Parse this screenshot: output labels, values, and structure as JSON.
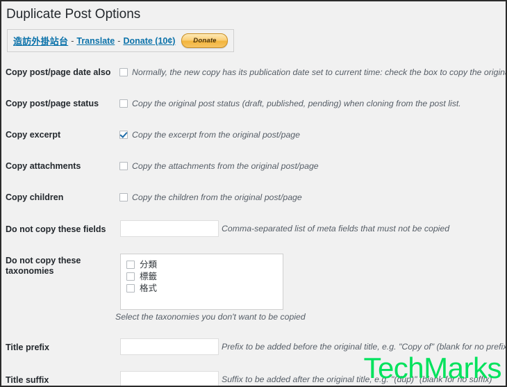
{
  "page": {
    "title": "Duplicate Post Options"
  },
  "linkbar": {
    "plugin_site_link": "造訪外掛站台",
    "translate_link": "Translate",
    "donate_link": "Donate (10¢)",
    "separator": "-",
    "donate_button": "Donate"
  },
  "colors": {
    "background": "#f1f1f1",
    "link": "#0b72aa",
    "title_text": "#23282d",
    "description_text": "#555d66",
    "checkbox_accent": "#1e6ca8",
    "watermark_green": "#00e25c",
    "border": "#2b2b2b"
  },
  "rows": [
    {
      "label": "Copy post/page date also",
      "type": "checkbox",
      "checked": false,
      "description": "Normally, the new copy has its publication date set to current time: check the box to copy the original p"
    },
    {
      "label": "Copy post/page status",
      "type": "checkbox",
      "checked": false,
      "description": "Copy the original post status (draft, published, pending) when cloning from the post list."
    },
    {
      "label": "Copy excerpt",
      "type": "checkbox",
      "checked": true,
      "description": "Copy the excerpt from the original post/page"
    },
    {
      "label": "Copy attachments",
      "type": "checkbox",
      "checked": false,
      "description": "Copy the attachments from the original post/page"
    },
    {
      "label": "Copy children",
      "type": "checkbox",
      "checked": false,
      "description": "Copy the children from the original post/page"
    },
    {
      "label": "Do not copy these fields",
      "type": "text",
      "value": "",
      "placeholder": "",
      "description": "Comma-separated list of meta fields that must not be copied"
    },
    {
      "label": "Do not copy these taxonomies",
      "type": "listbox",
      "description": "Select the taxonomies you don't want to be copied"
    },
    {
      "label": "Title prefix",
      "type": "text",
      "value": "",
      "placeholder": "",
      "description": "Prefix to be added before the original title, e.g. \"Copy of\" (blank for no prefix)"
    },
    {
      "label": "Title suffix",
      "type": "text",
      "value": "",
      "placeholder": "",
      "description": "Suffix to be added after the original title, e.g. \"(dup)\" (blank for no suffix)"
    }
  ],
  "taxonomies": [
    {
      "label": "分類",
      "checked": false
    },
    {
      "label": "標籤",
      "checked": false
    },
    {
      "label": "格式",
      "checked": false
    }
  ],
  "watermark": {
    "text": "TechMarks"
  }
}
